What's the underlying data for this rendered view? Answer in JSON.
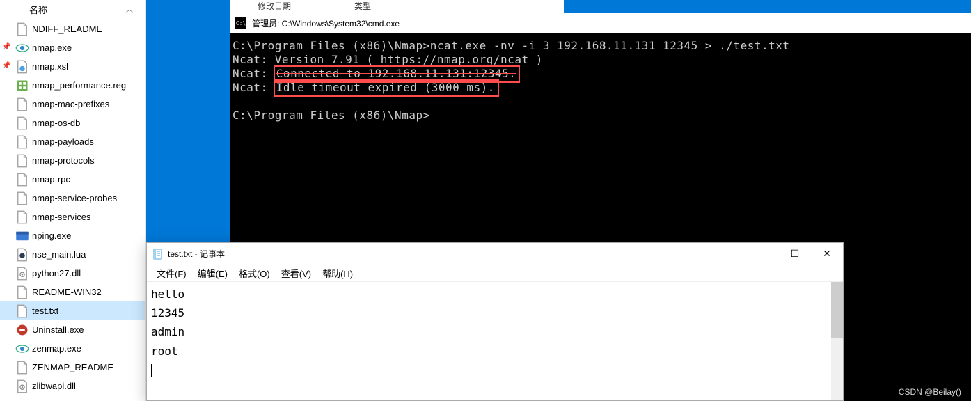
{
  "explorer": {
    "columnHeader": "名称",
    "files": [
      {
        "name": "NDIFF_README",
        "icon": "doc",
        "pinned": false,
        "selected": false
      },
      {
        "name": "nmap.exe",
        "icon": "exe-eye",
        "pinned": true,
        "selected": false
      },
      {
        "name": "nmap.xsl",
        "icon": "xsl",
        "pinned": true,
        "selected": false
      },
      {
        "name": "nmap_performance.reg",
        "icon": "reg",
        "pinned": false,
        "selected": false
      },
      {
        "name": "nmap-mac-prefixes",
        "icon": "doc",
        "pinned": false,
        "selected": false
      },
      {
        "name": "nmap-os-db",
        "icon": "doc",
        "pinned": false,
        "selected": false
      },
      {
        "name": "nmap-payloads",
        "icon": "doc",
        "pinned": false,
        "selected": false
      },
      {
        "name": "nmap-protocols",
        "icon": "doc",
        "pinned": false,
        "selected": false
      },
      {
        "name": "nmap-rpc",
        "icon": "doc",
        "pinned": false,
        "selected": false
      },
      {
        "name": "nmap-service-probes",
        "icon": "doc",
        "pinned": false,
        "selected": false
      },
      {
        "name": "nmap-services",
        "icon": "doc",
        "pinned": false,
        "selected": false
      },
      {
        "name": "nping.exe",
        "icon": "exe-blue",
        "pinned": false,
        "selected": false
      },
      {
        "name": "nse_main.lua",
        "icon": "lua",
        "pinned": false,
        "selected": false
      },
      {
        "name": "python27.dll",
        "icon": "dll",
        "pinned": false,
        "selected": false
      },
      {
        "name": "README-WIN32",
        "icon": "doc",
        "pinned": false,
        "selected": false
      },
      {
        "name": "test.txt",
        "icon": "txt",
        "pinned": false,
        "selected": true
      },
      {
        "name": "Uninstall.exe",
        "icon": "uninst",
        "pinned": false,
        "selected": false
      },
      {
        "name": "zenmap.exe",
        "icon": "exe-eye",
        "pinned": false,
        "selected": false
      },
      {
        "name": "ZENMAP_README",
        "icon": "doc",
        "pinned": false,
        "selected": false
      },
      {
        "name": "zlibwapi.dll",
        "icon": "dll",
        "pinned": false,
        "selected": false
      }
    ]
  },
  "tabsPeek": [
    "修改日期",
    "类型"
  ],
  "cmd": {
    "title": "管理员: C:\\Windows\\System32\\cmd.exe",
    "iconText": "C:\\",
    "lines": {
      "prompt1": "C:\\Program Files (x86)\\Nmap>",
      "command1": "ncat.exe -nv -i 3 192.168.11.131 12345 > ./test.txt",
      "out1": "Ncat: Version 7.91 ( https://nmap.org/ncat )",
      "out2pre": "Ncat: ",
      "out2highlight": "Connected to 192.168.11.131:12345.",
      "out3pre": "Ncat: ",
      "out3highlight": "Idle timeout expired (3000 ms).",
      "prompt2": "C:\\Program Files (x86)\\Nmap>"
    }
  },
  "notepad": {
    "title": "test.txt - 记事本",
    "menus": [
      "文件(F)",
      "编辑(E)",
      "格式(O)",
      "查看(V)",
      "帮助(H)"
    ],
    "content": [
      "hello",
      "12345",
      "admin",
      "root"
    ]
  },
  "watermark": "CSDN @Beilay()"
}
